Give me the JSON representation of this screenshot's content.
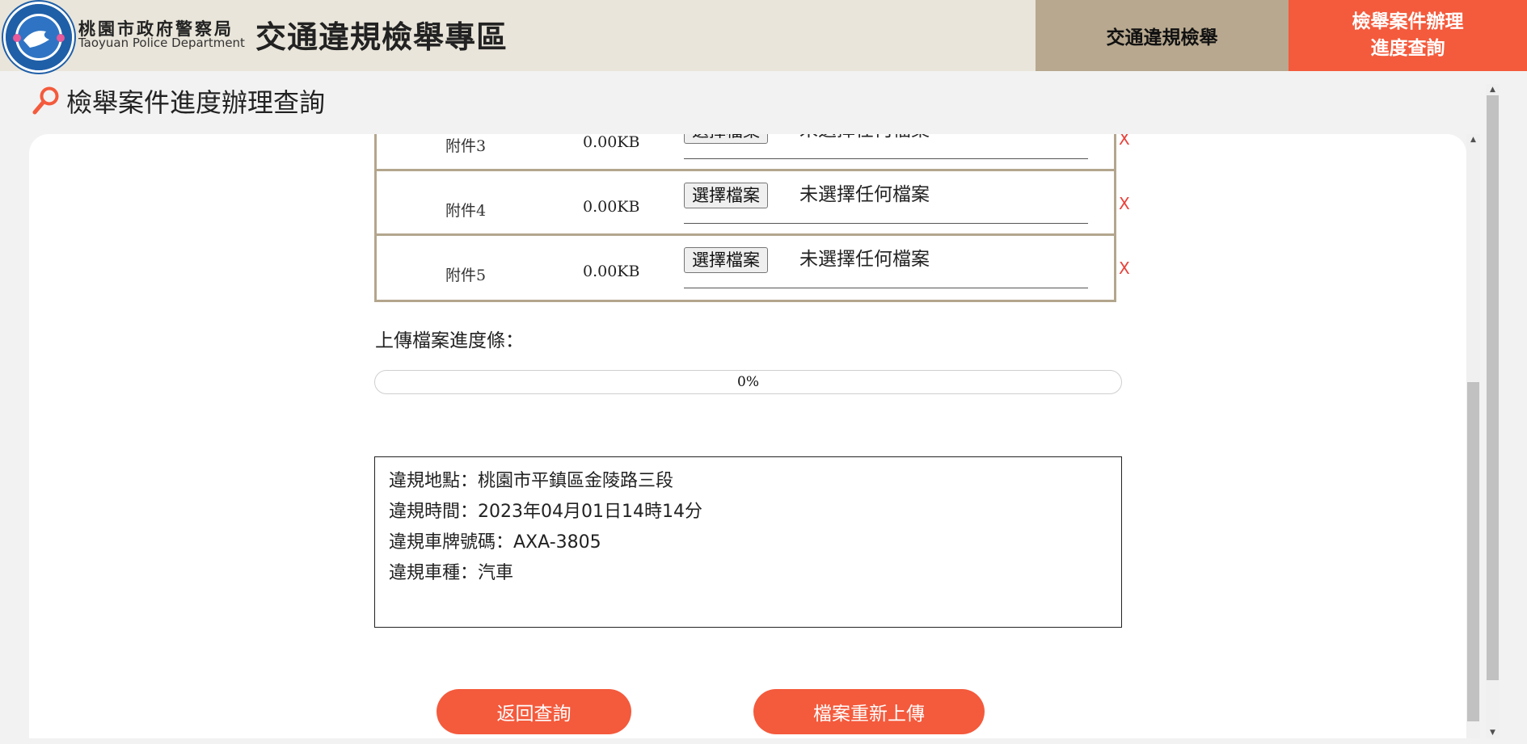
{
  "header": {
    "dept_name": "桃園市政府警察局",
    "dept_name_en": "Taoyuan Police Department",
    "site_title": "交通違規檢舉專區",
    "nav": {
      "report": "交通違規檢舉",
      "progress_line1": "檢舉案件辦理",
      "progress_line2": "進度查詢"
    }
  },
  "page": {
    "title": "檢舉案件進度辦理查詢"
  },
  "attachments": [
    {
      "name": "附件3",
      "size": "0.00KB",
      "button": "選擇檔案",
      "status": "未選擇任何檔案",
      "remove": "X"
    },
    {
      "name": "附件4",
      "size": "0.00KB",
      "button": "選擇檔案",
      "status": "未選擇任何檔案",
      "remove": "X"
    },
    {
      "name": "附件5",
      "size": "0.00KB",
      "button": "選擇檔案",
      "status": "未選擇任何檔案",
      "remove": "X"
    }
  ],
  "upload": {
    "label": "上傳檔案進度條：",
    "progress_value": 0,
    "progress_text": "0%"
  },
  "violation_info": {
    "location": "違規地點：桃園市平鎮區金陵路三段",
    "time": "違規時間：2023年04月01日14時14分",
    "plate": "違規車牌號碼：AXA-3805",
    "vehicle_type": "違規車種：汽車"
  },
  "buttons": {
    "back": "返回查詢",
    "reupload": "檔案重新上傳"
  },
  "colors": {
    "accent": "#f45a3c",
    "nav_tan": "#b7a88f",
    "header_bg": "#e9e5da",
    "table_border": "#b3a68d"
  }
}
